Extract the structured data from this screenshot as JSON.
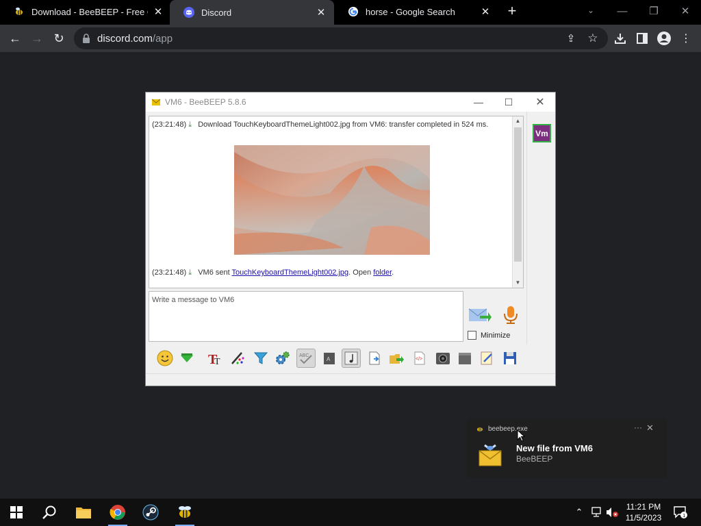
{
  "browser": {
    "tabs": [
      {
        "title": "Download - BeeBEEP - Free Offi",
        "icon": "beebeep-bee-icon",
        "active": false
      },
      {
        "title": "Discord",
        "icon": "discord-icon",
        "active": true
      },
      {
        "title": "horse - Google Search",
        "icon": "google-g-icon",
        "active": false
      }
    ],
    "new_tab_label": "+",
    "url_host": "discord.com",
    "url_path": "/app"
  },
  "beebeep": {
    "window_title": "VM6 - BeeBEEP 5.8.6",
    "messages": [
      {
        "time": "(23:21:48)",
        "text": "Download TouchKeyboardThemeLight002.jpg from VM6: transfer completed in 524 ms."
      },
      {
        "time": "(23:21:48)",
        "prefix": "VM6 sent ",
        "file_link": "TouchKeyboardThemeLight002.jpg",
        "middle": ". Open ",
        "folder_link": "folder",
        "suffix": "."
      }
    ],
    "compose_placeholder": "Write a message to VM6",
    "minimize_label": "Minimize",
    "minimize_checked": false,
    "user_avatar": "Vm",
    "avatar_color": "#7b2f7e",
    "avatar_border": "#2fb342"
  },
  "toast": {
    "app_name": "beebeep.exe",
    "heading": "New file from VM6",
    "subtitle": "BeeBEEP",
    "more": "···",
    "close": "✕"
  },
  "taskbar": {
    "time": "11:21 PM",
    "date": "11/5/2023",
    "notification_count": "1"
  }
}
